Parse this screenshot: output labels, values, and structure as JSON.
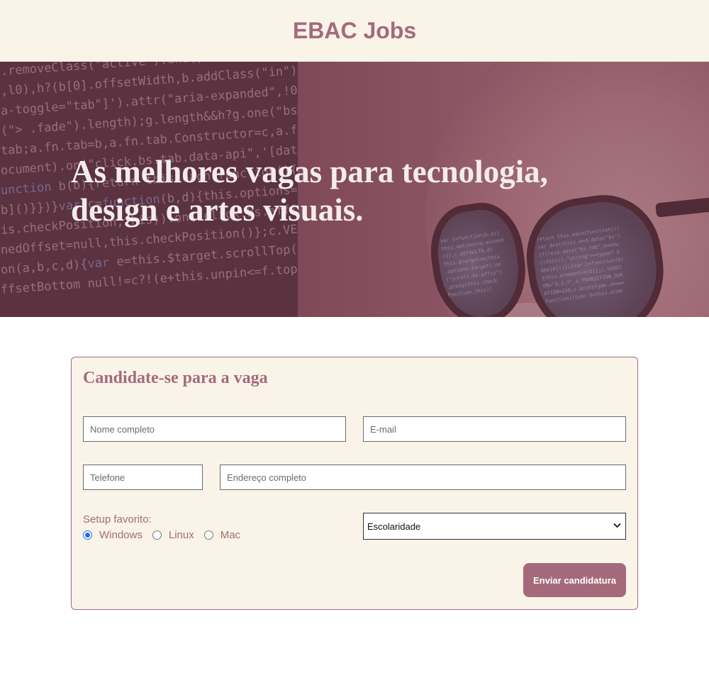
{
  "header": {
    "brand": "EBAC Jobs"
  },
  "hero": {
    "headline": "As melhores vagas para tecnologia, design e artes visuais."
  },
  "form": {
    "title": "Candidate-se para a vaga",
    "name_placeholder": "Nome completo",
    "email_placeholder": "E-mail",
    "phone_placeholder": "Telefone",
    "address_placeholder": "Endereço completo",
    "setup_label": "Setup favorito:",
    "setup_options": [
      {
        "label": "Windows",
        "selected": true
      },
      {
        "label": "Linux",
        "selected": false
      },
      {
        "label": "Mac",
        "selected": false
      }
    ],
    "education_select": "Escolaridade",
    "submit_label": "Enviar candidatura"
  },
  "colors": {
    "brand": "#a46a7c",
    "cream": "#f9f4e7",
    "radio_accent": "#1a73e8"
  },
  "icons": {
    "select_chevron": "chevron-down-icon"
  }
}
